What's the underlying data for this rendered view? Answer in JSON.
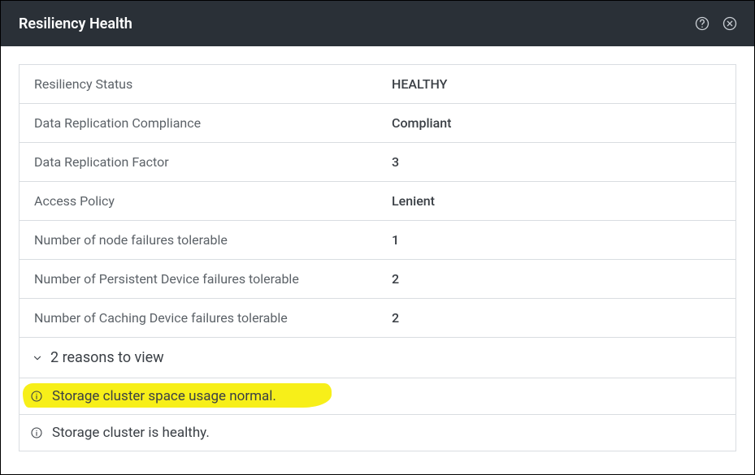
{
  "header": {
    "title": "Resiliency Health"
  },
  "rows": [
    {
      "label": "Resiliency Status",
      "value": "HEALTHY"
    },
    {
      "label": "Data Replication Compliance",
      "value": "Compliant"
    },
    {
      "label": "Data Replication Factor",
      "value": "3"
    },
    {
      "label": "Access Policy",
      "value": "Lenient"
    },
    {
      "label": "Number of node failures tolerable",
      "value": "1"
    },
    {
      "label": "Number of Persistent Device failures tolerable",
      "value": "2"
    },
    {
      "label": "Number of Caching Device failures tolerable",
      "value": "2"
    }
  ],
  "expander": {
    "label": "2 reasons to view"
  },
  "reasons": [
    {
      "text": "Storage cluster space usage normal.",
      "highlight": true
    },
    {
      "text": "Storage cluster is healthy.",
      "highlight": false
    }
  ]
}
